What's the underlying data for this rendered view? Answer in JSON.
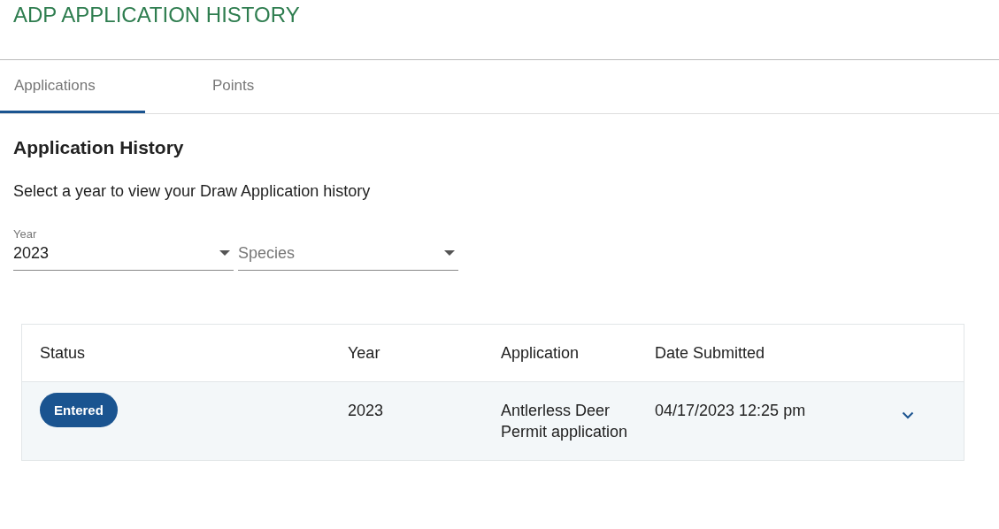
{
  "page_title": "ADP APPLICATION HISTORY",
  "tabs": [
    {
      "label": "Applications",
      "selected": true
    },
    {
      "label": "Points",
      "selected": false
    }
  ],
  "section_title": "Application History",
  "instructions": "Select a year to view your Draw Application history",
  "filters": [
    {
      "label": "Year",
      "value": "2023"
    },
    {
      "placeholder": "Species"
    }
  ],
  "table": {
    "columns": [
      "Status",
      "Year",
      "Application",
      "Date Submitted"
    ],
    "rows": [
      {
        "status": "Entered",
        "year": "2023",
        "application": "Antlerless Deer Permit application",
        "date_submitted": "04/17/2023 12:25 pm",
        "expanded": false
      }
    ]
  }
}
